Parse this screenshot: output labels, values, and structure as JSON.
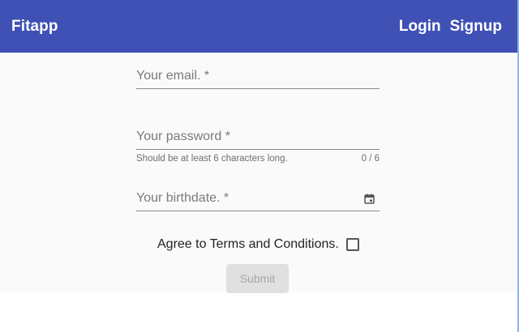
{
  "header": {
    "brand": "Fitapp",
    "nav": [
      {
        "label": "Login"
      },
      {
        "label": "Signup"
      }
    ],
    "color": "#3f51b5"
  },
  "form": {
    "email": {
      "placeholder": "Your email. *",
      "value": ""
    },
    "password": {
      "placeholder": "Your password *",
      "value": "",
      "hint": "Should be at least 6 characters long.",
      "counter": "0 / 6"
    },
    "birthdate": {
      "placeholder": "Your birthdate. *",
      "value": "",
      "icon": "calendar-icon"
    },
    "terms": {
      "label": "Agree to Terms and Conditions.",
      "checked": false
    },
    "submit": {
      "label": "Submit",
      "disabled": true
    }
  }
}
